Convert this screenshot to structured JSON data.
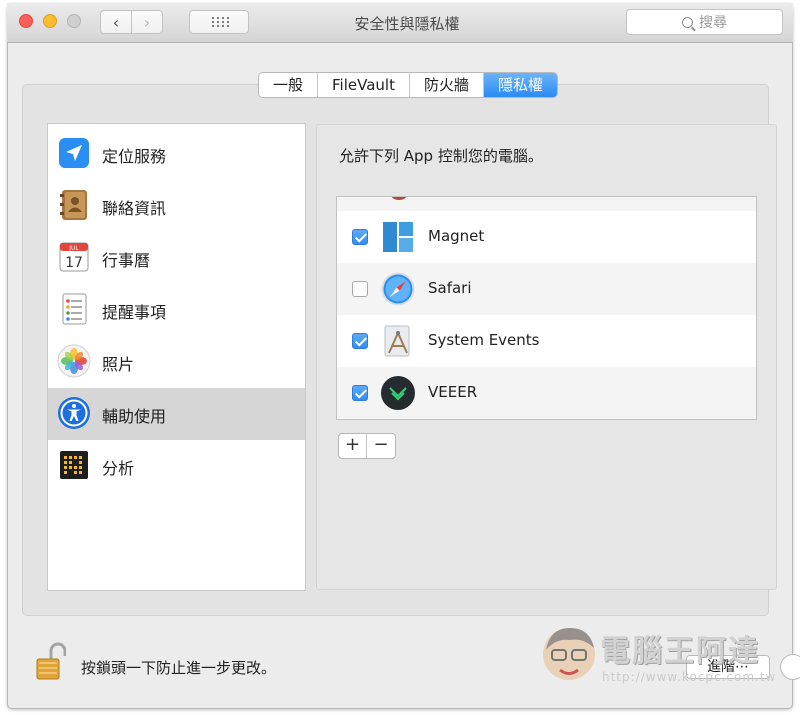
{
  "window": {
    "title": "安全性與隱私權",
    "search_placeholder": "搜尋"
  },
  "tabs": [
    {
      "label": "一般",
      "selected": false
    },
    {
      "label": "FileVault",
      "selected": false
    },
    {
      "label": "防火牆",
      "selected": false
    },
    {
      "label": "隱私權",
      "selected": true
    }
  ],
  "sidebar": {
    "items": [
      {
        "label": "定位服務",
        "icon": "location-arrow-icon",
        "selected": false
      },
      {
        "label": "聯絡資訊",
        "icon": "contacts-book-icon",
        "selected": false
      },
      {
        "label": "行事曆",
        "icon": "calendar-icon",
        "selected": false,
        "icon_text": {
          "month": "JUL",
          "day": "17"
        }
      },
      {
        "label": "提醒事項",
        "icon": "reminders-icon",
        "selected": false
      },
      {
        "label": "照片",
        "icon": "photos-icon",
        "selected": false
      },
      {
        "label": "輔助使用",
        "icon": "accessibility-icon",
        "selected": true
      },
      {
        "label": "分析",
        "icon": "analytics-icon",
        "selected": false
      }
    ]
  },
  "main": {
    "allow_label": "允許下列 App 控制您的電腦。",
    "apps": [
      {
        "name": "Magnet",
        "checked": true,
        "icon": "magnet-app-icon"
      },
      {
        "name": "Safari",
        "checked": false,
        "icon": "safari-compass-icon"
      },
      {
        "name": "System Events",
        "checked": true,
        "icon": "system-events-icon"
      },
      {
        "name": "VEEER",
        "checked": true,
        "icon": "veeer-app-icon"
      }
    ],
    "add_label": "+",
    "remove_label": "−"
  },
  "footer": {
    "lock_label": "按鎖頭一下防止進一步更改。",
    "advanced_label": "進階⋯"
  },
  "watermark": {
    "text": "電腦王阿達",
    "url": "http://www.kocpc.com.tw"
  },
  "colors": {
    "accent": "#2a8bf2",
    "selected_row": "#d6d6d6"
  }
}
